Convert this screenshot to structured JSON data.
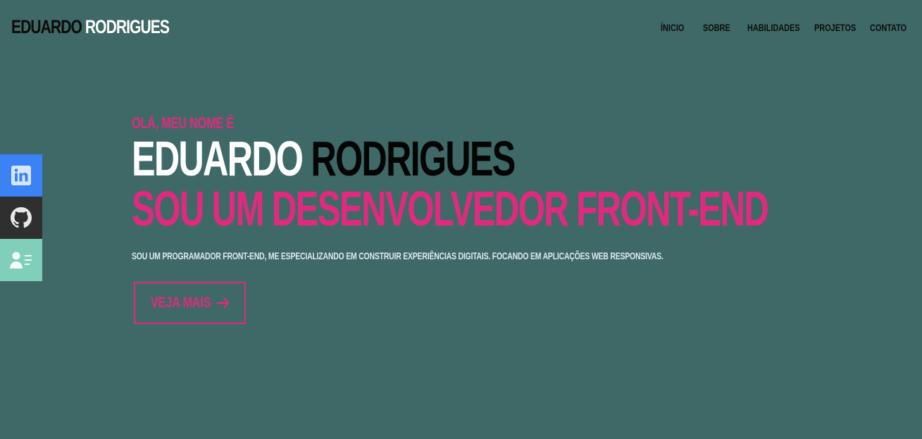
{
  "header": {
    "logo_first": "EDUARDO",
    "logo_last": "RODRIGUES",
    "nav": [
      "ÍNICIO",
      "SOBRE",
      "HABILIDADES",
      "PROJETOS",
      "CONTATO"
    ]
  },
  "social": [
    {
      "name": "linkedin",
      "icon": "linkedin-icon",
      "color": "#3b82f6"
    },
    {
      "name": "github",
      "icon": "github-icon",
      "color": "#2f2f2f"
    },
    {
      "name": "resume",
      "icon": "resume-icon",
      "color": "#7fcfba"
    }
  ],
  "hero": {
    "greeting": "OLÁ, MEU NOME É",
    "name_first": "EDUARDO",
    "name_last": "RODRIGUES",
    "role": "SOU UM DESENVOLVEDOR FRONT-END",
    "description": "SOU UM PROGRAMADOR FRONT-END, ME ESPECIALIZANDO EM CONSTRUIR EXPERIÊNCIAS DIGITAIS. FOCANDO EM APLICAÇÕES WEB RESPONSIVAS.",
    "cta_label": "VEJA MAIS"
  },
  "colors": {
    "background": "#3e6966",
    "accent": "#e12a7f",
    "text_dark": "#0b0b0b",
    "text_light": "#ffffff"
  }
}
